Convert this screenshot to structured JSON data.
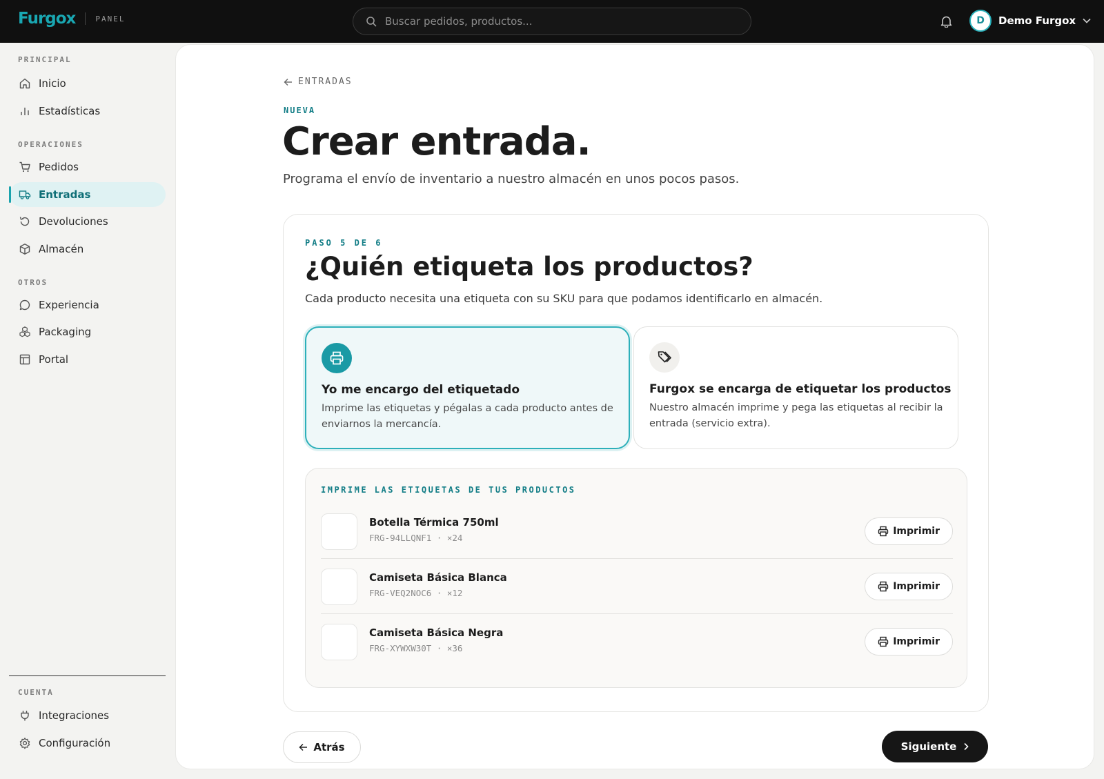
{
  "topbar": {
    "brand": "Furgox",
    "panel_label": "PANEL",
    "search_placeholder": "Buscar pedidos, productos...",
    "user_initial": "D",
    "user_name": "Demo Furgox"
  },
  "sidebar": {
    "sections": [
      {
        "title": "PRINCIPAL",
        "items": [
          {
            "label": "Inicio",
            "icon": "home-icon"
          },
          {
            "label": "Estadísticas",
            "icon": "bar-chart-icon"
          }
        ]
      },
      {
        "title": "OPERACIONES",
        "items": [
          {
            "label": "Pedidos",
            "icon": "cart-icon"
          },
          {
            "label": "Entradas",
            "icon": "truck-icon",
            "active": true
          },
          {
            "label": "Devoluciones",
            "icon": "return-icon"
          },
          {
            "label": "Almacén",
            "icon": "box-icon"
          }
        ]
      },
      {
        "title": "OTROS",
        "items": [
          {
            "label": "Experiencia",
            "icon": "chat-icon"
          },
          {
            "label": "Packaging",
            "icon": "boxes-icon"
          },
          {
            "label": "Portal",
            "icon": "layout-icon"
          }
        ]
      },
      {
        "title": "CUENTA",
        "items": [
          {
            "label": "Integraciones",
            "icon": "plug-icon"
          },
          {
            "label": "Configuración",
            "icon": "gear-icon"
          }
        ]
      }
    ]
  },
  "main": {
    "back_label": "ENTRADAS",
    "eyebrow": "NUEVA",
    "title": "Crear entrada.",
    "subtitle": "Programa el envío de inventario a nuestro almacén en unos pocos pasos.",
    "step_label": "PASO 5 DE 6",
    "question": "¿Quién etiqueta los productos?",
    "question_sub": "Cada producto necesita una etiqueta con su SKU para que podamos identificarlo en almacén.",
    "options": [
      {
        "title": "Yo me encargo del etiquetado",
        "desc": "Imprime las etiquetas y pégalas a cada producto antes de enviarnos la mercancía.",
        "icon": "printer-icon",
        "selected": true
      },
      {
        "title": "Furgox se encarga de etiquetar los productos",
        "desc": "Nuestro almacén imprime y pega las etiquetas al recibir la entrada (servicio extra).",
        "icon": "tags-icon",
        "selected": false
      }
    ],
    "labels_title": "IMPRIME LAS ETIQUETAS DE TUS PRODUCTOS",
    "print_label": "Imprimir",
    "products": [
      {
        "name": "Botella Térmica 750ml",
        "meta": "FRG-94LLQNF1 · ×24"
      },
      {
        "name": "Camiseta Básica Blanca",
        "meta": "FRG-VEQ2NOC6 · ×12"
      },
      {
        "name": "Camiseta Básica Negra",
        "meta": "FRG-XYWXW30T · ×36"
      }
    ],
    "back_button": "Atrás",
    "next_button": "Siguiente"
  },
  "colors": {
    "accent": "#1aa3ad",
    "accent_dark": "#127d86",
    "topbar": "#101010",
    "primary_button": "#161616"
  }
}
